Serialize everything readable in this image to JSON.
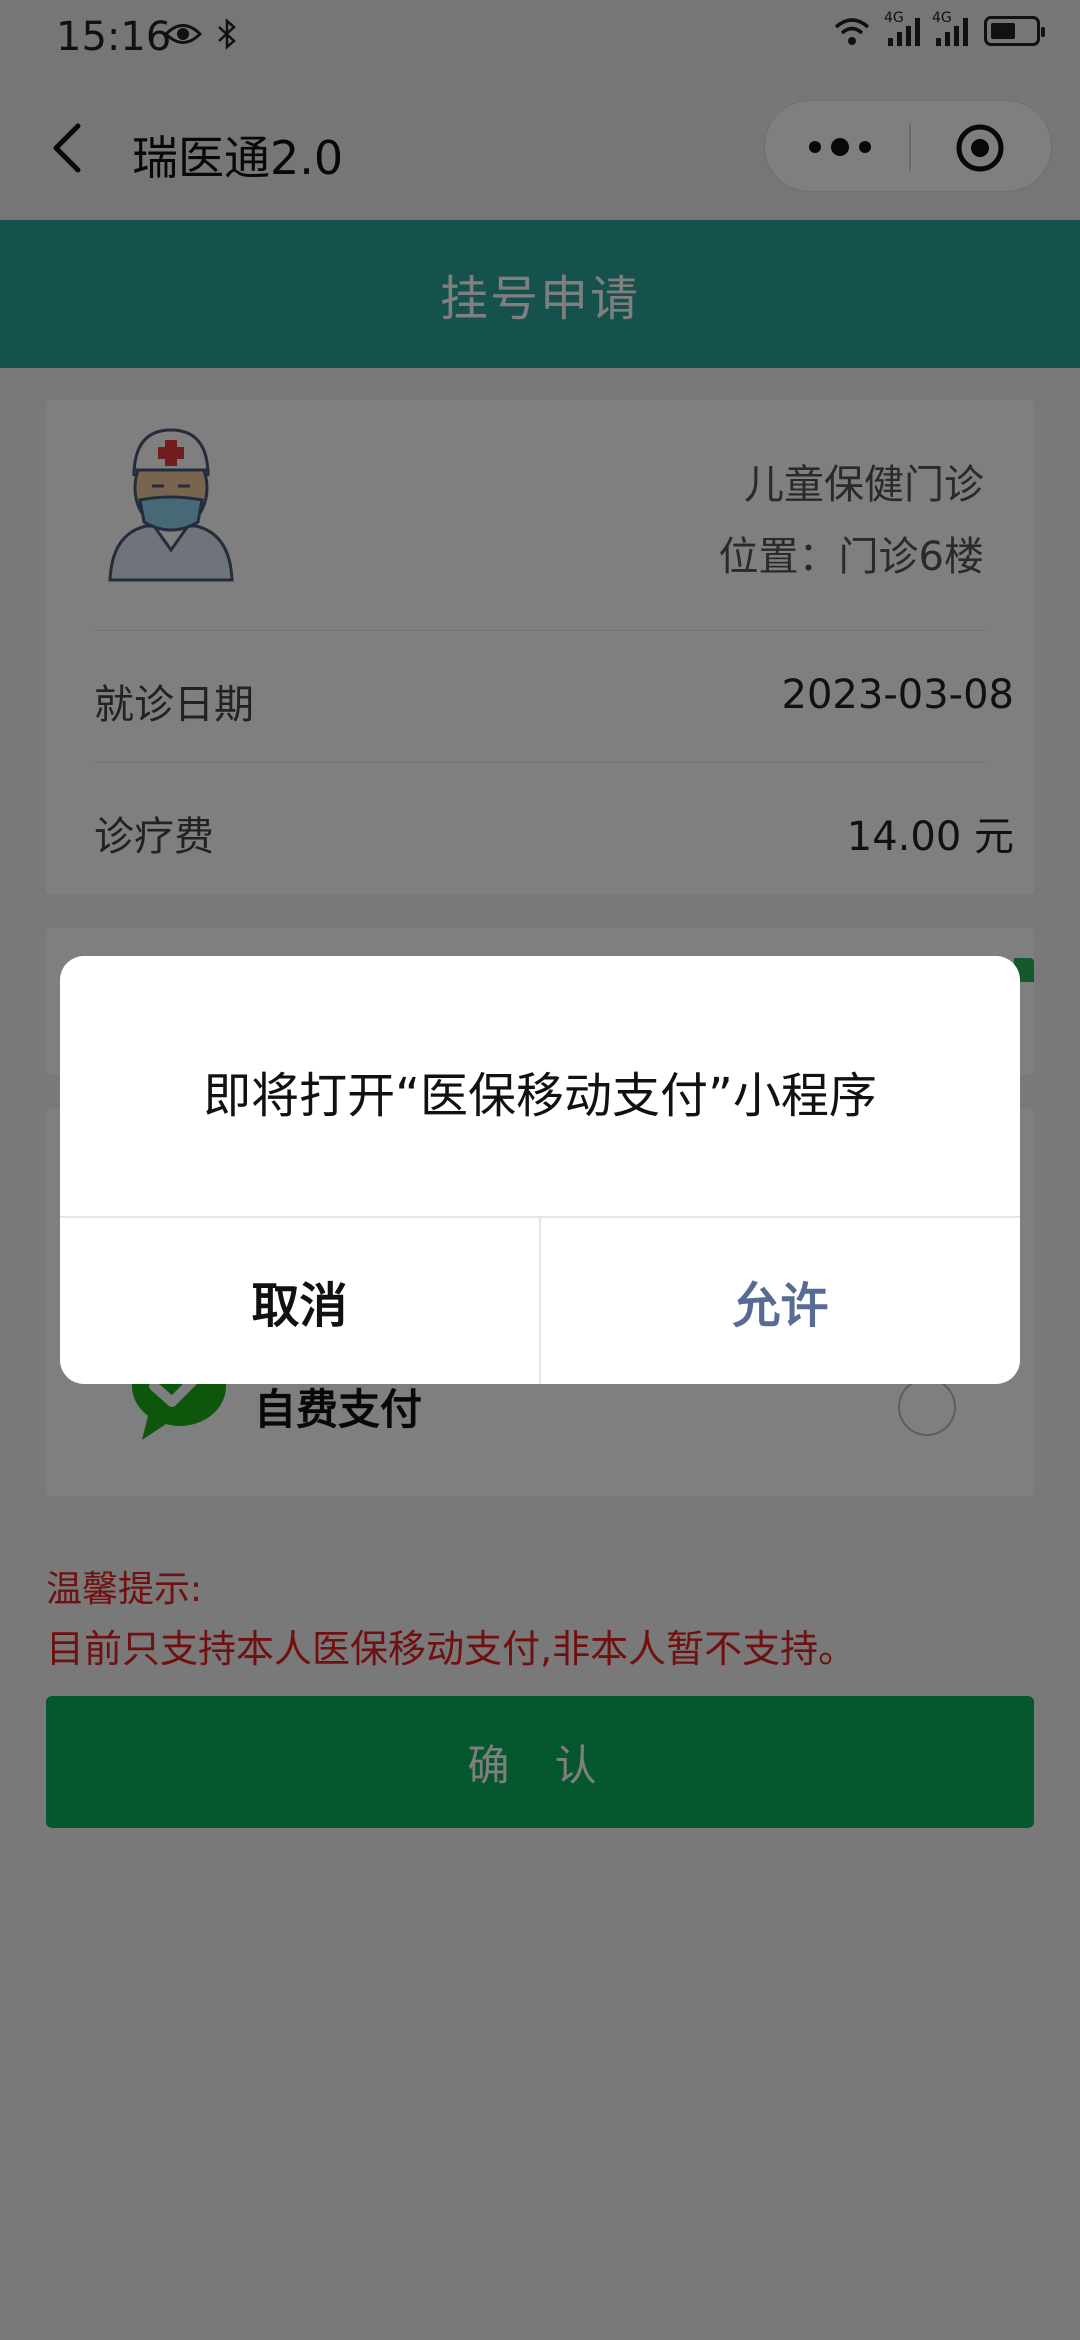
{
  "status_bar": {
    "time": "15:16",
    "signal_label_1": "4G",
    "signal_label_2": "4G",
    "battery_level": 0.55
  },
  "nav": {
    "title": "瑞医通2.0"
  },
  "header": {
    "title": "挂号申请"
  },
  "card": {
    "department": "儿童保健门诊",
    "location": "位置：门诊6楼",
    "date_label": "就诊日期",
    "date_value": "2023-03-08",
    "fee_label": "诊疗费",
    "fee_value": "14.00 元"
  },
  "payment": {
    "self_pay_label": "自费支付"
  },
  "notice": {
    "title": "温馨提示:",
    "text": "目前只支持本人医保移动支付,非本人暂不支持。"
  },
  "confirm_button": {
    "label": "确 认"
  },
  "dialog": {
    "message": "即将打开“医保移动支付”小程序",
    "cancel_label": "取消",
    "allow_label": "允许"
  },
  "colors": {
    "header_bg": "#2aa59a",
    "confirm_bg": "#0aae5a",
    "notice_text": "#e02020",
    "allow_text": "#576b95"
  }
}
